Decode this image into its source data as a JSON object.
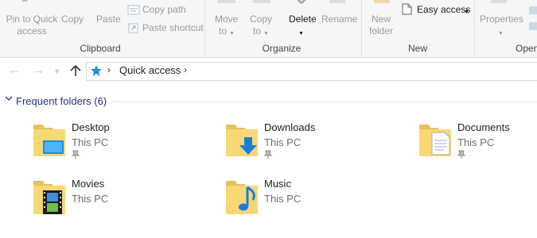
{
  "ribbon": {
    "clipboard": {
      "pin_label_1": "Pin to Quick",
      "pin_label_2": "access",
      "copy_label": "Copy",
      "paste_label": "Paste",
      "copy_path_label": "Copy path",
      "paste_shortcut_label": "Paste shortcut",
      "group_label": "Clipboard"
    },
    "organize": {
      "move_label_1": "Move",
      "move_label_2": "to",
      "copy_label_1": "Copy",
      "copy_label_2": "to",
      "delete_label": "Delete",
      "rename_label": "Rename",
      "group_label": "Organize"
    },
    "new": {
      "new_folder_label_1": "New",
      "new_folder_label_2": "folder",
      "easy_access_label": "Easy access",
      "group_label": "New"
    },
    "open": {
      "properties_label": "Properties",
      "group_label": "Open"
    }
  },
  "address": {
    "location": "Quick access"
  },
  "group": {
    "title": "Frequent folders (6)"
  },
  "items": [
    {
      "name": "Desktop",
      "location": "This PC",
      "pinned": true,
      "icon": "desktop-folder-icon"
    },
    {
      "name": "Downloads",
      "location": "This PC",
      "pinned": true,
      "icon": "downloads-folder-icon"
    },
    {
      "name": "Documents",
      "location": "This PC",
      "pinned": true,
      "icon": "documents-folder-icon"
    },
    {
      "name": "Movies",
      "location": "This PC",
      "pinned": false,
      "icon": "movies-folder-icon"
    },
    {
      "name": "Music",
      "location": "This PC",
      "pinned": false,
      "icon": "music-folder-icon"
    }
  ],
  "colors": {
    "accent": "#0078d7",
    "group_title": "#1e3287",
    "folder_yellow": "#f8d775"
  }
}
